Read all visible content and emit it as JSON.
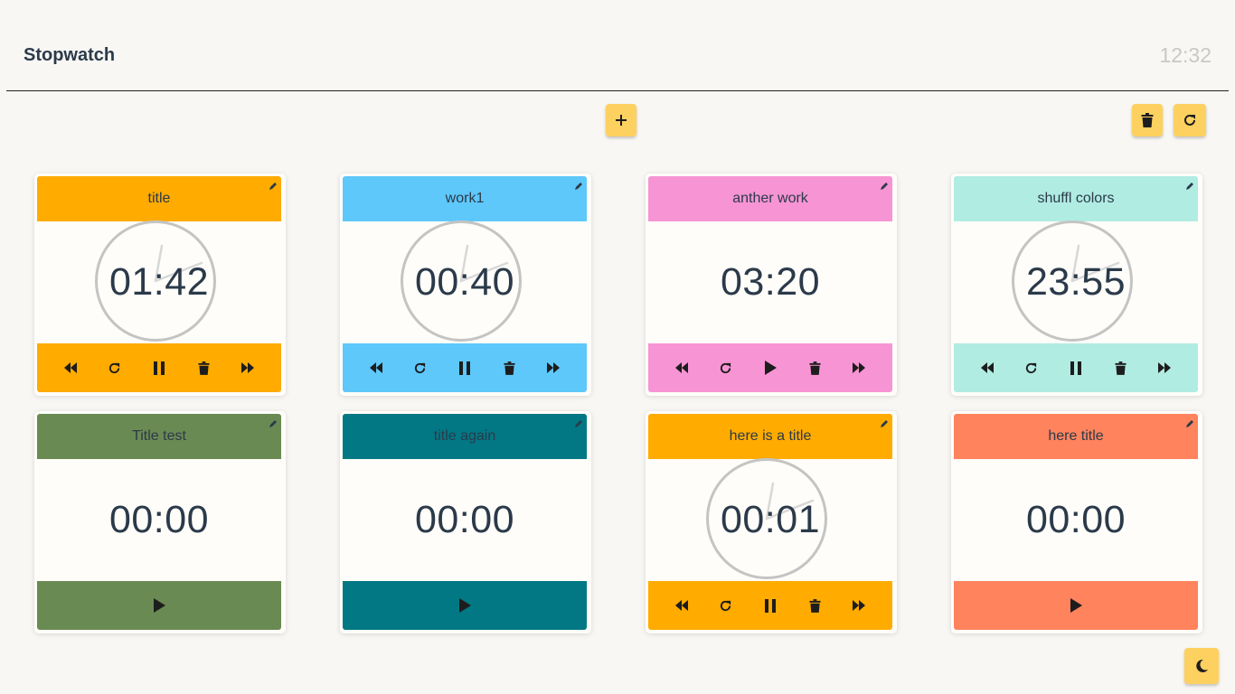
{
  "header": {
    "title": "Stopwatch",
    "clock": "12:32"
  },
  "toolbar": {
    "add_icon": "plus-icon",
    "delete_all_icon": "trash-icon",
    "reset_all_icon": "redo-icon"
  },
  "theme_toggle_icon": "moon-icon",
  "accent": "#fdd160",
  "cards": [
    {
      "title": "title",
      "time": "01:42",
      "color": "#ffab00",
      "running": true,
      "dial": true
    },
    {
      "title": "work1",
      "time": "00:40",
      "color": "#5ec8fb",
      "running": true,
      "dial": true
    },
    {
      "title": "anther work",
      "time": "03:20",
      "color": "#f794d4",
      "running": false,
      "dial": false
    },
    {
      "title": "shuffl colors",
      "time": "23:55",
      "color": "#b0ece2",
      "running": true,
      "dial": true
    },
    {
      "title": "Title test",
      "time": "00:00",
      "color": "#6a8a53",
      "running": false,
      "dial": false,
      "fresh": true
    },
    {
      "title": "title again",
      "time": "00:00",
      "color": "#017884",
      "running": false,
      "dial": false,
      "fresh": true
    },
    {
      "title": "here is a title",
      "time": "00:01",
      "color": "#ffab00",
      "running": true,
      "dial": true
    },
    {
      "title": "here title",
      "time": "00:00",
      "color": "#ff835d",
      "running": false,
      "dial": false,
      "fresh": true
    }
  ]
}
